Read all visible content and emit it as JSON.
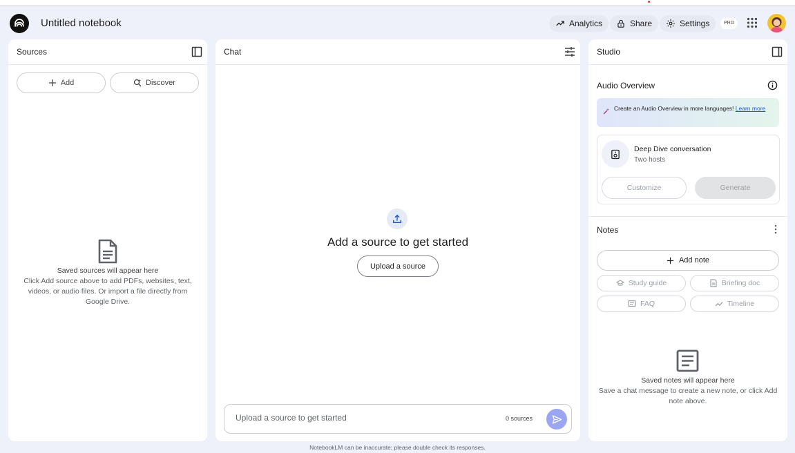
{
  "header": {
    "title": "Untitled notebook",
    "analytics_label": "Analytics",
    "share_label": "Share",
    "settings_label": "Settings",
    "pro_badge": "PRO"
  },
  "sources": {
    "title": "Sources",
    "add_label": "Add",
    "discover_label": "Discover",
    "empty_title": "Saved sources will appear here",
    "empty_body": "Click Add source above to add PDFs, websites, text, videos, or audio files. Or import a file directly from Google Drive."
  },
  "chat": {
    "title": "Chat",
    "heading": "Add a source to get started",
    "upload_button": "Upload a source",
    "input_placeholder": "Upload a source to get started",
    "source_count": "0 sources"
  },
  "studio": {
    "title": "Studio",
    "audio_overview_title": "Audio Overview",
    "banner_text": "Create an Audio Overview in more languages!",
    "banner_link": "Learn more",
    "card_title": "Deep Dive conversation",
    "card_subtitle": "Two hosts",
    "customize_label": "Customize",
    "generate_label": "Generate",
    "notes_title": "Notes",
    "add_note_label": "Add note",
    "note_actions": [
      "Study guide",
      "Briefing doc",
      "FAQ",
      "Timeline"
    ],
    "notes_empty_title": "Saved notes will appear here",
    "notes_empty_body": "Save a chat message to create a new note, or click Add note above."
  },
  "footer": {
    "disclaimer": "NotebookLM can be inaccurate; please double check its responses."
  },
  "colors": {
    "background": "#eef1f9",
    "panel": "#ffffff",
    "send_button": "#9ba6f3",
    "link": "#1a56d6"
  }
}
